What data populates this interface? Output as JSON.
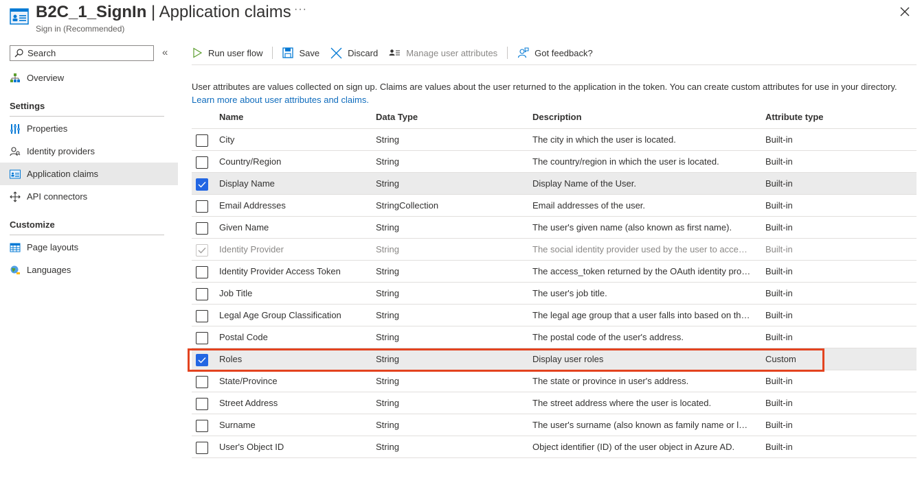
{
  "header": {
    "title_bold": "B2C_1_SignIn",
    "title_rest": " | Application claims",
    "subtitle": "Sign in (Recommended)",
    "more": "···"
  },
  "sidebar": {
    "search_placeholder": "Search",
    "collapse": "«",
    "overview": "Overview",
    "settings_heading": "Settings",
    "settings_items": [
      {
        "label": "Properties",
        "icon": "properties-icon"
      },
      {
        "label": "Identity providers",
        "icon": "identity-providers-icon"
      },
      {
        "label": "Application claims",
        "icon": "application-claims-icon",
        "active": true
      },
      {
        "label": "API connectors",
        "icon": "api-connectors-icon"
      }
    ],
    "customize_heading": "Customize",
    "customize_items": [
      {
        "label": "Page layouts",
        "icon": "page-layouts-icon"
      },
      {
        "label": "Languages",
        "icon": "languages-icon"
      }
    ]
  },
  "toolbar": {
    "run": "Run user flow",
    "save": "Save",
    "discard": "Discard",
    "manage": "Manage user attributes",
    "feedback": "Got feedback?"
  },
  "description": {
    "text": "User attributes are values collected on sign up. Claims are values about the user returned to the application in the token. You can create custom attributes for use in your directory.",
    "link": "Learn more about user attributes and claims."
  },
  "table": {
    "headers": {
      "name": "Name",
      "type": "Data Type",
      "desc": "Description",
      "attr": "Attribute type"
    },
    "rows": [
      {
        "name": "City",
        "type": "String",
        "desc": "The city in which the user is located.",
        "attr": "Built-in",
        "checked": false
      },
      {
        "name": "Country/Region",
        "type": "String",
        "desc": "The country/region in which the user is located.",
        "attr": "Built-in",
        "checked": false
      },
      {
        "name": "Display Name",
        "type": "String",
        "desc": "Display Name of the User.",
        "attr": "Built-in",
        "checked": true
      },
      {
        "name": "Email Addresses",
        "type": "StringCollection",
        "desc": "Email addresses of the user.",
        "attr": "Built-in",
        "checked": false
      },
      {
        "name": "Given Name",
        "type": "String",
        "desc": "The user's given name (also known as first name).",
        "attr": "Built-in",
        "checked": false
      },
      {
        "name": "Identity Provider",
        "type": "String",
        "desc": "The social identity provider used by the user to access your application.",
        "attr": "Built-in",
        "checked": true,
        "disabled": true
      },
      {
        "name": "Identity Provider Access Token",
        "type": "String",
        "desc": "The access_token returned by the OAuth identity provider.",
        "attr": "Built-in",
        "checked": false
      },
      {
        "name": "Job Title",
        "type": "String",
        "desc": "The user's job title.",
        "attr": "Built-in",
        "checked": false
      },
      {
        "name": "Legal Age Group Classification",
        "type": "String",
        "desc": "The legal age group that a user falls into based on their age.",
        "attr": "Built-in",
        "checked": false
      },
      {
        "name": "Postal Code",
        "type": "String",
        "desc": "The postal code of the user's address.",
        "attr": "Built-in",
        "checked": false
      },
      {
        "name": "Roles",
        "type": "String",
        "desc": "Display user roles",
        "attr": "Custom",
        "checked": true
      },
      {
        "name": "State/Province",
        "type": "String",
        "desc": "The state or province in user's address.",
        "attr": "Built-in",
        "checked": false
      },
      {
        "name": "Street Address",
        "type": "String",
        "desc": "The street address where the user is located.",
        "attr": "Built-in",
        "checked": false
      },
      {
        "name": "Surname",
        "type": "String",
        "desc": "The user's surname (also known as family name or last name).",
        "attr": "Built-in",
        "checked": false
      },
      {
        "name": "User's Object ID",
        "type": "String",
        "desc": "Object identifier (ID) of the user object in Azure AD.",
        "attr": "Built-in",
        "checked": false
      }
    ]
  },
  "colors": {
    "accent": "#2266e3",
    "link": "#0f6cbd",
    "highlight_box": "#e3431f",
    "selected_row": "#ebebeb"
  }
}
